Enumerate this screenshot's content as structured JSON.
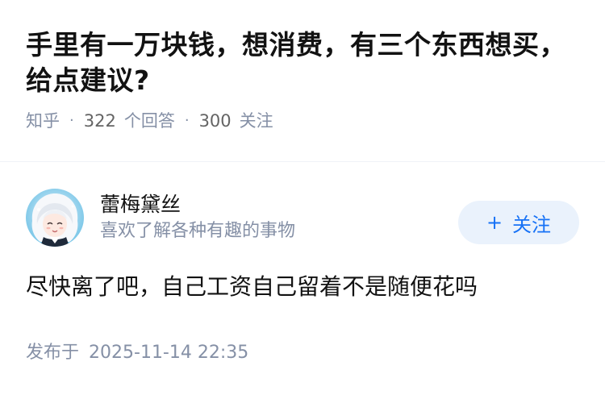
{
  "question": {
    "title": "手里有一万块钱，想消费，有三个东西想买，给点建议?",
    "source": "知乎",
    "answer_count": "322",
    "answer_label": "个回答",
    "follower_count": "300",
    "follower_label": "关注",
    "separator": "·"
  },
  "answer": {
    "author": {
      "name": "蕾梅黛丝",
      "bio": "喜欢了解各种有趣的事物",
      "avatar_icon": "anime-avatar-icon"
    },
    "follow_button": {
      "icon": "+",
      "label": "关注"
    },
    "content": "尽快离了吧，自己工资自己留着不是随便花吗",
    "published_label": "发布于",
    "published_time": "2025-11-14 22:35"
  },
  "colors": {
    "text_primary": "#121212",
    "text_secondary": "#8590a6",
    "accent": "#1772f6",
    "follow_bg": "#eaf2fc"
  }
}
